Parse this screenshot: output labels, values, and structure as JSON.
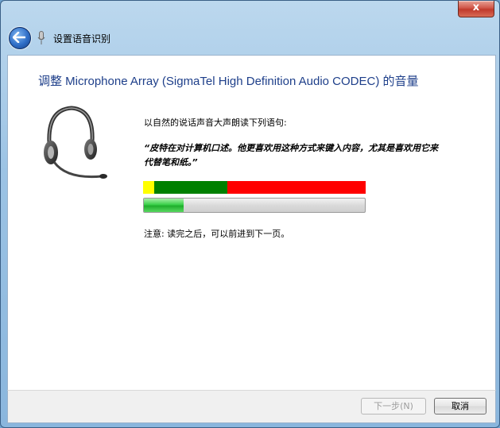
{
  "window": {
    "close_glyph": "x"
  },
  "nav": {
    "title": "设置语音识别"
  },
  "main": {
    "heading": "调整 Microphone Array (SigmaTel High Definition Audio CODEC) 的音量",
    "instruction": "以自然的说话声音大声朗读下列语句:",
    "quote_line1": "“皮特在对计算机口述。他更喜欢用这种方式来键入内容，尤其是喜欢用它来",
    "quote_line2": "代替笔和纸。”",
    "level_meter": {
      "colors": {
        "low": "#ffff00",
        "good": "#008000",
        "high": "#ff0000"
      }
    },
    "volume_progress": 0.18,
    "note": "注意: 读完之后，可以前进到下一页。"
  },
  "footer": {
    "next_label": "下一步(N)",
    "cancel_label": "取消"
  }
}
